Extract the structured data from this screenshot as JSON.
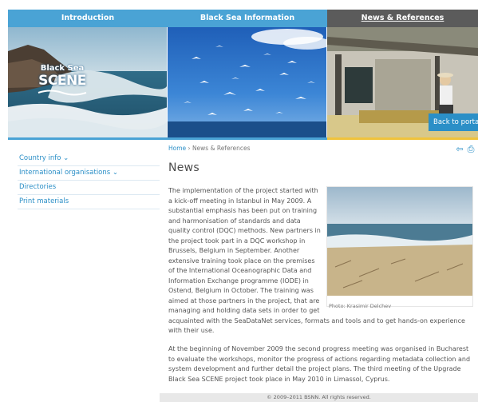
{
  "nav": {
    "tabs": [
      {
        "label": "Introduction"
      },
      {
        "label": "Black Sea Information"
      },
      {
        "label": "News & References"
      }
    ]
  },
  "banner": {
    "logo_top": "Black Sea",
    "logo_main": "SCENE",
    "back_button": "Back to portal"
  },
  "sidebar": {
    "items": [
      {
        "label": "Country info"
      },
      {
        "label": "International organisations"
      },
      {
        "label": "Directories"
      },
      {
        "label": "Print materials"
      }
    ]
  },
  "breadcrumb": {
    "home": "Home",
    "separator": " › ",
    "current": "News & References"
  },
  "tools": {
    "back_icon": "⇦",
    "print_icon": "⎙"
  },
  "main": {
    "title": "News",
    "paragraph1": "The implementation of the project started with a kick-off meeting in Istanbul in May 2009. A substantial emphasis has been put on training and harmonisation of standards and data quality control (DQC) methods. New partners in the project took part in a DQC workshop in Brussels, Belgium in September. Another extensive training took place on the premises of the International Oceanographic Data and Information Exchange programme (IODE) in Ostend, Belgium in October. The training was aimed at those partners in the project, that are managing and holding data sets in order to get acquainted with the SeaDataNet services, formats and tools and to get hands-on experience with their use.",
    "image_caption": "Photo: Krasimir Delchev",
    "paragraph2": "At the beginning of November 2009 the second progress meeting was organised in Bucharest to evaluate the workshops, monitor the progress of actions regarding metadata collection and system development and further detail the project plans. The third meeting of the Upgrade Black Sea SCENE project took place in May 2010 in Limassol, Cyprus."
  },
  "footer": {
    "text": "© 2009–2011 BSNN. All rights reserved."
  },
  "colors": {
    "accent_blue": "#4aa3d5",
    "link_blue": "#2b8fc7",
    "dark_tab": "#5b5b5b"
  }
}
